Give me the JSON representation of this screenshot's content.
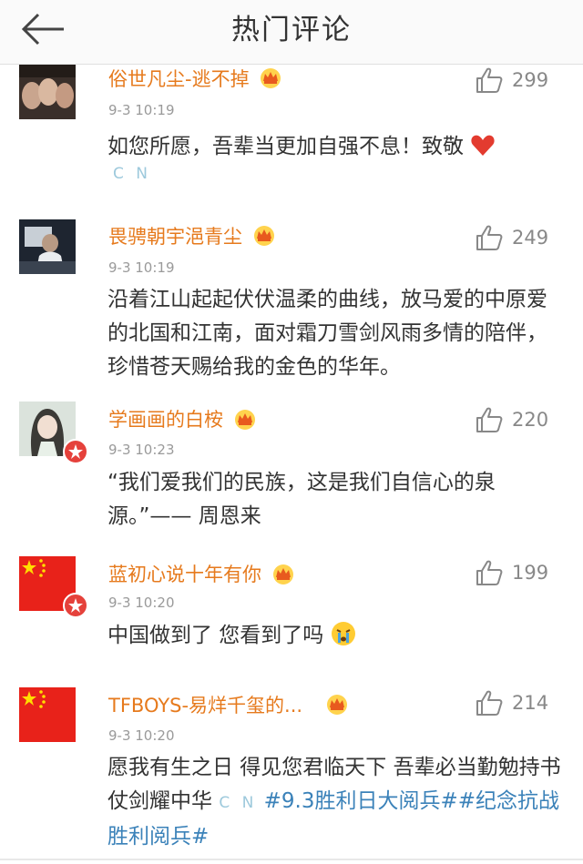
{
  "header": {
    "title": "热门评论"
  },
  "comments": [
    {
      "name": "俗世凡尘-逃不掉",
      "time": "9-3 10:19",
      "likes": "299",
      "text": "如您所愿，吾辈当更加自强不息！致敬",
      "emoji": "heart-icon",
      "cn": "C N"
    },
    {
      "name": "畏骋朝宇浥青尘",
      "time": "9-3 10:19",
      "likes": "249",
      "text": "沿着江山起起伏伏温柔的曲线，放马爱的中原爱的北国和江南，面对霜刀雪剑风雨多情的陪伴，珍惜苍天赐给我的金色的华年。"
    },
    {
      "name": "学画画的白桉",
      "time": "9-3 10:23",
      "likes": "220",
      "text": "“我们爱我们的民族，这是我们自信心的泉源。”—— 周恩来"
    },
    {
      "name": "蓝初心说十年有你",
      "time": "9-3 10:20",
      "likes": "199",
      "text": "中国做到了 您看到了吗",
      "emoji": "crying-face-icon"
    },
    {
      "name": "TFBOYS-易烊千玺的...",
      "time": "9-3 10:20",
      "likes": "214",
      "text_a": "愿我有生之日 得见您君临天下 吾辈必当勤勉持书仗剑耀中华",
      "cn": "C N",
      "topic": "#9.3胜利日大阅兵##纪念抗战胜利阅兵#"
    }
  ],
  "colors": {
    "name": "#e67a1d",
    "topic": "#3b82b9",
    "badge": "#e5413b"
  }
}
